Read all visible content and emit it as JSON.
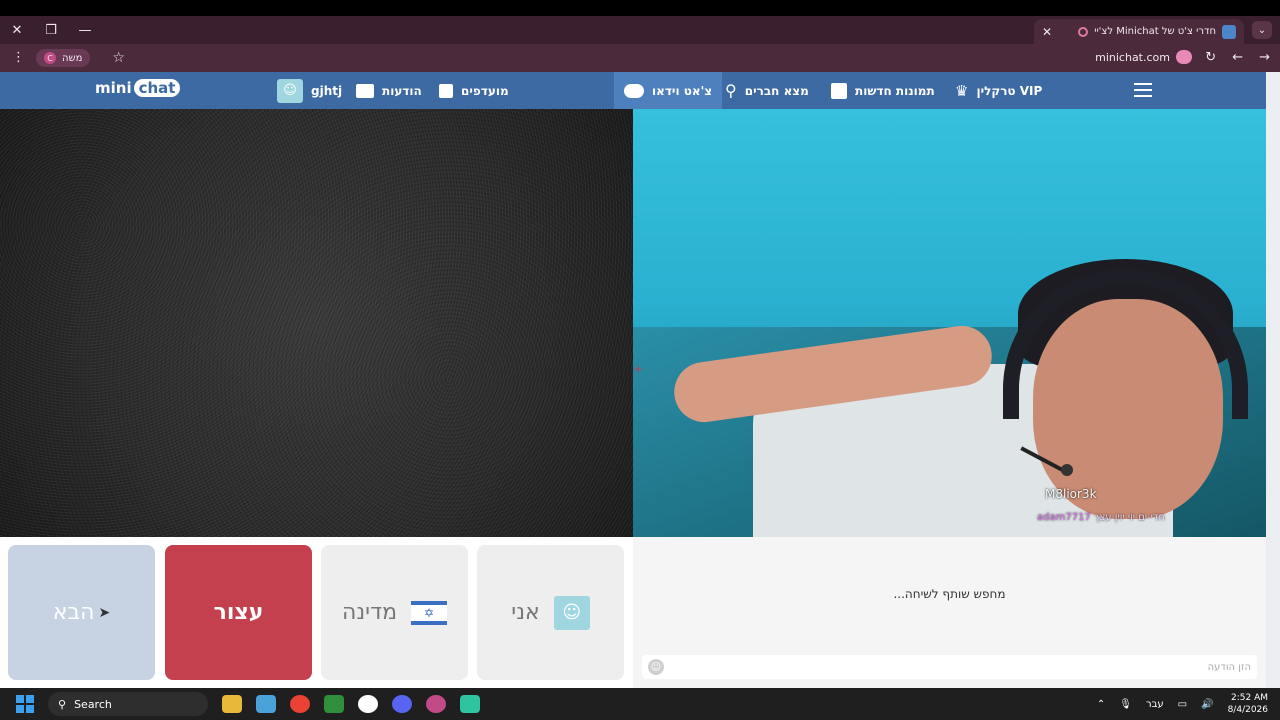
{
  "browser": {
    "tab_title": "חדרי צ'ט של Minichat לצ'יי",
    "new_tab": "+",
    "url": "minichat.com",
    "profile_name": "משה",
    "profile_initial": "C"
  },
  "site": {
    "logo_mini": "mini",
    "logo_chat": "chat",
    "username": "gjhtj",
    "nav": {
      "messages": "הודעות",
      "favorites": "מועדפים",
      "video_chat": "צ'אט וידאו",
      "find_friends": "מצא חברים",
      "new_photos": "תמונות חדשות",
      "vip": "VIP טרקלין"
    }
  },
  "video": {
    "partner_name": "M8lior3k",
    "overlay_user": "adam7717",
    "overlay_text": "חדי-ים יוי יוין עצך"
  },
  "controls": {
    "next_label": "הבא",
    "stop_label": "עצור",
    "country_label": "מדינה",
    "me_label": "אני"
  },
  "chat": {
    "status": "...מחפש שותף לשיחה",
    "placeholder": "הזן הודעה"
  },
  "taskbar": {
    "search": "Search",
    "lang": "עבר",
    "time": "2:52 AM",
    "date": "8/4/2026"
  },
  "colors": {
    "header_blue": "#3d6aa3",
    "stop_red": "#c4404e",
    "browser_frame": "#3a1f2e"
  }
}
